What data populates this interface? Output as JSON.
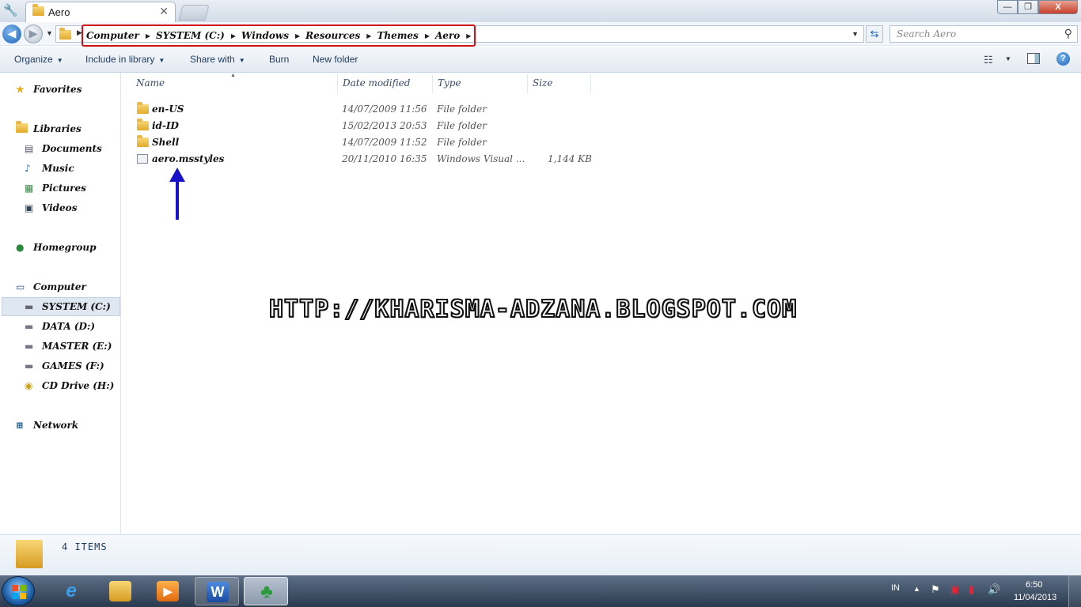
{
  "window": {
    "tab_title": "Aero",
    "close_glyph": "✕",
    "min_glyph": "—",
    "max_glyph": "❐",
    "close_btn_glyph": "X"
  },
  "address": {
    "breadcrumbs": [
      "Computer",
      "SYSTEM (C:)",
      "Windows",
      "Resources",
      "Themes",
      "Aero"
    ]
  },
  "search": {
    "placeholder": "Search Aero"
  },
  "toolbar": {
    "organize": "Organize",
    "include_in_library": "Include in library",
    "share_with": "Share with",
    "burn": "Burn",
    "new_folder": "New folder"
  },
  "nav": {
    "favorites": "Favorites",
    "libraries": "Libraries",
    "documents": "Documents",
    "music": "Music",
    "pictures": "Pictures",
    "videos": "Videos",
    "homegroup": "Homegroup",
    "computer": "Computer",
    "drive_c": "SYSTEM (C:)",
    "drive_d": "DATA (D:)",
    "drive_e": "MASTER (E:)",
    "drive_f": "GAMES (F:)",
    "drive_h": "CD Drive (H:)",
    "network": "Network"
  },
  "columns": {
    "name": "Name",
    "date": "Date modified",
    "type": "Type",
    "size": "Size"
  },
  "files": [
    {
      "name": "en-US",
      "date": "14/07/2009 11:56",
      "type": "File folder",
      "size": ""
    },
    {
      "name": "id-ID",
      "date": "15/02/2013 20:53",
      "type": "File folder",
      "size": ""
    },
    {
      "name": "Shell",
      "date": "14/07/2009 11:52",
      "type": "File folder",
      "size": ""
    },
    {
      "name": "aero.msstyles",
      "date": "20/11/2010 16:35",
      "type": "Windows Visual ...",
      "size": "1,144 KB"
    }
  ],
  "watermark": "HTTP://KHARISMA-ADZANA.BLOGSPOT.COM",
  "details": {
    "item_count": "4 ITEMS"
  },
  "taskbar": {
    "language": "IN",
    "time": "6:50",
    "date": "11/04/2013",
    "word_glyph": "W"
  },
  "colors": {
    "annotation_box": "#d20f16",
    "annotation_arrow": "#1a12c8"
  }
}
